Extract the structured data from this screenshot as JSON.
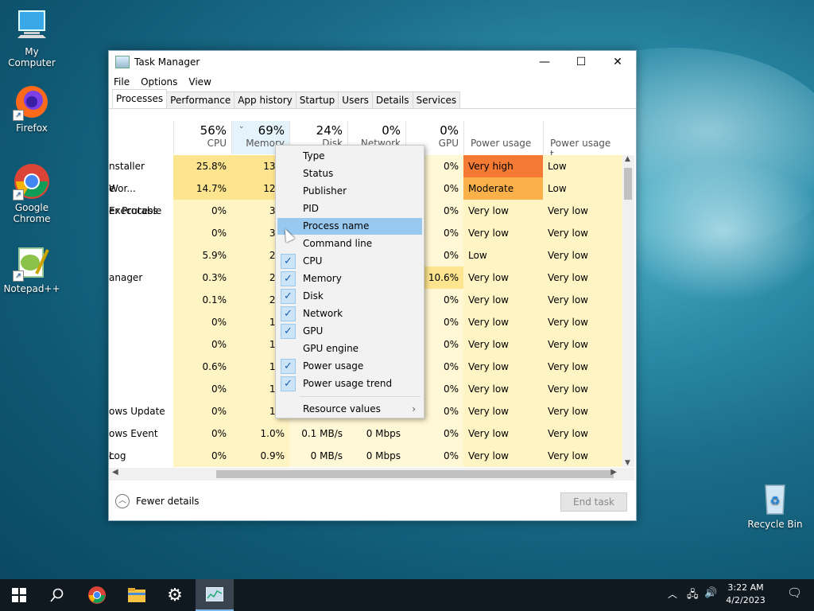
{
  "desktop": {
    "icons": [
      {
        "label": "My Computer"
      },
      {
        "label": "Firefox"
      },
      {
        "label": "Google Chrome"
      },
      {
        "label": "Notepad++"
      },
      {
        "label": "Recycle Bin"
      }
    ]
  },
  "window": {
    "title": "Task Manager",
    "controls": {
      "minimize": "—",
      "maximize": "☐",
      "close": "✕"
    },
    "menu": [
      "File",
      "Options",
      "View"
    ],
    "tabs": [
      "Processes",
      "Performance",
      "App history",
      "Startup",
      "Users",
      "Details",
      "Services"
    ],
    "active_tab": "Processes"
  },
  "columns": {
    "cpu": {
      "pct": "56%",
      "label": "CPU"
    },
    "memory": {
      "pct": "69%",
      "label": "Memory"
    },
    "disk": {
      "pct": "24%",
      "label": "Disk"
    },
    "network": {
      "pct": "0%",
      "label": "Network"
    },
    "gpu": {
      "pct": "0%",
      "label": "GPU"
    },
    "power": {
      "label": "Power usage"
    },
    "power_trend": {
      "label": "Power usage t..."
    }
  },
  "rows": [
    {
      "name": "nstaller Wor...",
      "cpu": "25.8%",
      "mem": "13.5",
      "disk": "",
      "net": "",
      "gpu": "0%",
      "power": "Very high",
      "trend": "Low"
    },
    {
      "name": "e Executable",
      "cpu": "14.7%",
      "mem": "12.6",
      "disk": "",
      "net": "",
      "gpu": "0%",
      "power": "Moderate",
      "trend": "Low"
    },
    {
      "name": "er Process",
      "cpu": "0%",
      "mem": "3.9",
      "disk": "",
      "net": "",
      "gpu": "0%",
      "power": "Very low",
      "trend": "Very low"
    },
    {
      "name": "",
      "cpu": "0%",
      "mem": "3.5",
      "disk": "",
      "net": "",
      "gpu": "0%",
      "power": "Very low",
      "trend": "Very low"
    },
    {
      "name": "",
      "cpu": "5.9%",
      "mem": "2.9",
      "disk": "",
      "net": "",
      "gpu": "0%",
      "power": "Low",
      "trend": "Very low"
    },
    {
      "name": "anager",
      "cpu": "0.3%",
      "mem": "2.5",
      "disk": "",
      "net": "",
      "gpu": "10.6%",
      "power": "Very low",
      "trend": "Very low"
    },
    {
      "name": "",
      "cpu": "0.1%",
      "mem": "2.0",
      "disk": "",
      "net": "",
      "gpu": "0%",
      "power": "Very low",
      "trend": "Very low"
    },
    {
      "name": "",
      "cpu": "0%",
      "mem": "1.5",
      "disk": "",
      "net": "",
      "gpu": "0%",
      "power": "Very low",
      "trend": "Very low"
    },
    {
      "name": "",
      "cpu": "0%",
      "mem": "1.3",
      "disk": "",
      "net": "",
      "gpu": "0%",
      "power": "Very low",
      "trend": "Very low"
    },
    {
      "name": "",
      "cpu": "0.6%",
      "mem": "1.3",
      "disk": "",
      "net": "",
      "gpu": "0%",
      "power": "Very low",
      "trend": "Very low"
    },
    {
      "name": "",
      "cpu": "0%",
      "mem": "1.2",
      "disk": "",
      "net": "",
      "gpu": "0%",
      "power": "Very low",
      "trend": "Very low"
    },
    {
      "name": "ows Update",
      "cpu": "0%",
      "mem": "1.1",
      "disk": "",
      "net": "",
      "gpu": "0%",
      "power": "Very low",
      "trend": "Very low"
    },
    {
      "name": "ows Event Log",
      "cpu": "0%",
      "mem": "1.0%",
      "disk": "0.1 MB/s",
      "net": "0 Mbps",
      "gpu": "0%",
      "power": "Very low",
      "trend": "Very low"
    },
    {
      "name": "c",
      "cpu": "0%",
      "mem": "0.9%",
      "disk": "0 MB/s",
      "net": "0 Mbps",
      "gpu": "0%",
      "power": "Very low",
      "trend": "Very low"
    }
  ],
  "context_menu": {
    "items": [
      {
        "label": "Type",
        "checked": false
      },
      {
        "label": "Status",
        "checked": false
      },
      {
        "label": "Publisher",
        "checked": false
      },
      {
        "label": "PID",
        "checked": false
      },
      {
        "label": "Process name",
        "checked": false,
        "highlighted": true
      },
      {
        "label": "Command line",
        "checked": false
      },
      {
        "label": "CPU",
        "checked": true
      },
      {
        "label": "Memory",
        "checked": true
      },
      {
        "label": "Disk",
        "checked": true
      },
      {
        "label": "Network",
        "checked": true
      },
      {
        "label": "GPU",
        "checked": true
      },
      {
        "label": "GPU engine",
        "checked": false
      },
      {
        "label": "Power usage",
        "checked": true
      },
      {
        "label": "Power usage trend",
        "checked": true
      }
    ],
    "submenu": {
      "label": "Resource values",
      "arrow": "›"
    },
    "check_glyph": "✓"
  },
  "footer": {
    "fewer_details": "Fewer details",
    "end_task": "End task"
  },
  "taskbar": {
    "time": "3:22 AM",
    "date": "4/2/2023"
  },
  "colors": {
    "very_high": "#f57b34",
    "moderate": "#fbb14a",
    "low_heat": "#fde58f",
    "cell_light": "#fff4c4",
    "cell_lighter": "#fff8d6",
    "highlight": "#99c9ef"
  }
}
